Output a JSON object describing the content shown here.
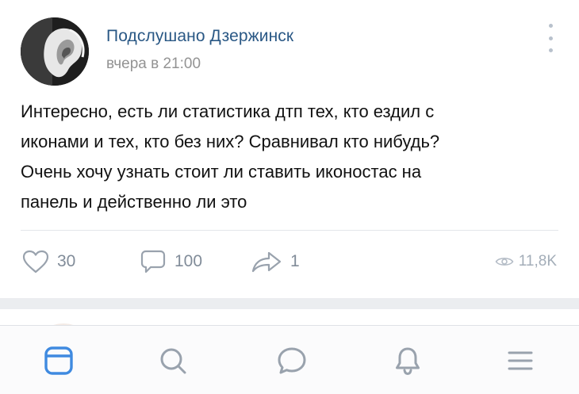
{
  "post": {
    "group_name": "Подслушано Дзержинск",
    "time": "вчера в 21:00",
    "text_lines": [
      "Интересно, есть ли статистика дтп тех, кто ездил с",
      "иконами и тех, кто без них? Сравнивал кто нибудь?",
      "Очень хочу узнать стоит ли ставить иконостас на",
      "панель и действенно ли это"
    ],
    "likes": "30",
    "comments": "100",
    "shares": "1",
    "views": "11,8K"
  },
  "icons": {
    "like": "heart-icon",
    "comment": "comment-bubble-icon",
    "share": "share-arrow-icon",
    "views": "eye-icon",
    "more": "more-vertical-icon"
  },
  "tabbar": {
    "items": [
      "news-feed-icon",
      "search-icon",
      "messages-icon",
      "notifications-bell-icon",
      "menu-icon"
    ],
    "active_color": "#3f8ae0",
    "inactive_color": "#99a2ad"
  },
  "colors": {
    "link": "#2a5885",
    "secondary": "#939393",
    "action": "#818c99",
    "accent": "#3f8ae0"
  }
}
